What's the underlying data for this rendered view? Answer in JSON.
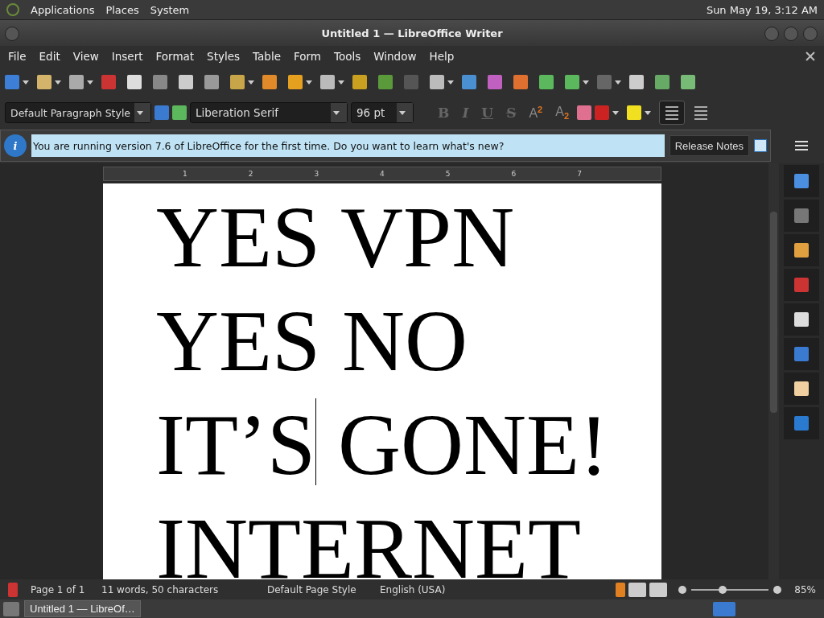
{
  "top_panel": {
    "menus": [
      "Applications",
      "Places",
      "System"
    ],
    "clock": "Sun May 19, 3:12 AM"
  },
  "window": {
    "title": "Untitled 1 — LibreOffice Writer"
  },
  "menu_bar": [
    "File",
    "Edit",
    "View",
    "Insert",
    "Format",
    "Styles",
    "Table",
    "Form",
    "Tools",
    "Window",
    "Help"
  ],
  "formatting": {
    "paragraph_style": "Default Paragraph Style",
    "font_name": "Liberation Serif",
    "font_size": "96 pt",
    "text_buttons": [
      "B",
      "I",
      "U",
      "S"
    ],
    "script_buttons": [
      "A$^{2}$",
      "A$_{2}$"
    ],
    "align": [
      {
        "selected": true
      },
      {
        "selected": false
      }
    ]
  },
  "infobar": {
    "icon": "i",
    "message": "You are running version 7.6 of LibreOffice for the first time. Do you want to learn what's new?",
    "button": "Release Notes"
  },
  "ruler": [
    "1",
    "2",
    "3",
    "4",
    "5",
    "6",
    "7"
  ],
  "document": {
    "lines": [
      {
        "segments": [
          {
            "text": "YES VPN",
            "cursor_after": false
          }
        ]
      },
      {
        "segments": [
          {
            "text": "YES NO",
            "cursor_after": false
          }
        ]
      },
      {
        "segments": [
          {
            "text": "IT’S",
            "cursor_after": true
          },
          {
            "text": " GONE!",
            "cursor_after": false
          }
        ]
      },
      {
        "segments": [
          {
            "text": "INTERNET",
            "cursor_after": false
          }
        ]
      }
    ]
  },
  "status_bar": {
    "page": "Page 1 of 1",
    "words": "11 words, 50 characters",
    "page_style": "Default Page Style",
    "language": "English (USA)",
    "zoom": {
      "level": 0.4
    },
    "zoom_reading": "85%"
  },
  "taskbar": {
    "items": [
      {
        "label": "Untitled 1 — LibreOf…",
        "selected": true
      }
    ]
  }
}
